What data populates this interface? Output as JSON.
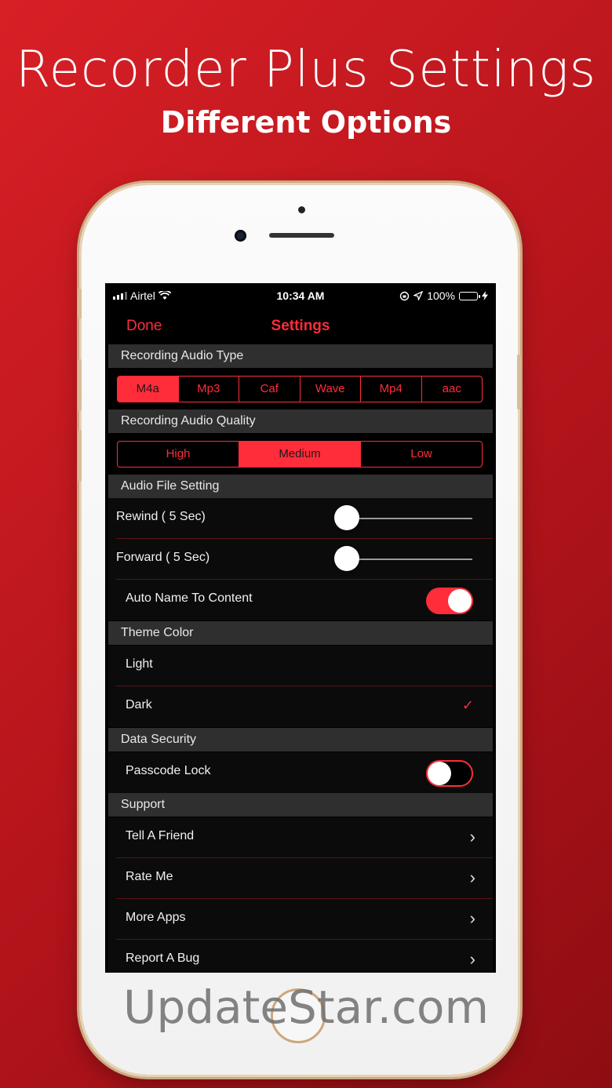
{
  "promo": {
    "title": "Recorder Plus Settings",
    "subtitle": "Different Options"
  },
  "watermark": "UpdateStar.com",
  "status_bar": {
    "carrier": "Airtel",
    "time": "10:34 AM",
    "battery": "100%"
  },
  "nav": {
    "done": "Done",
    "title": "Settings"
  },
  "colors": {
    "accent": "#ff2d3a",
    "background": "#000000",
    "section_header": "#2f2f2f"
  },
  "sections": {
    "audio_type": {
      "header": "Recording Audio Type",
      "options": [
        "M4a",
        "Mp3",
        "Caf",
        "Wave",
        "Mp4",
        "aac"
      ],
      "selected": "M4a"
    },
    "audio_quality": {
      "header": "Recording Audio Quality",
      "options": [
        "High",
        "Medium",
        "Low"
      ],
      "selected": "Medium"
    },
    "file_setting": {
      "header": "Audio File Setting",
      "rewind_label": "Rewind ( 5 Sec)",
      "rewind_value": 0,
      "forward_label": "Forward ( 5 Sec)",
      "forward_value": 0,
      "auto_name_label": "Auto Name To Content",
      "auto_name_on": true
    },
    "theme": {
      "header": "Theme Color",
      "light_label": "Light",
      "dark_label": "Dark",
      "selected": "Dark"
    },
    "security": {
      "header": "Data Security",
      "passcode_label": "Passcode Lock",
      "passcode_on": false
    },
    "support": {
      "header": "Support",
      "items": [
        "Tell A Friend",
        "Rate Me",
        "More Apps",
        "Report A Bug"
      ]
    }
  }
}
